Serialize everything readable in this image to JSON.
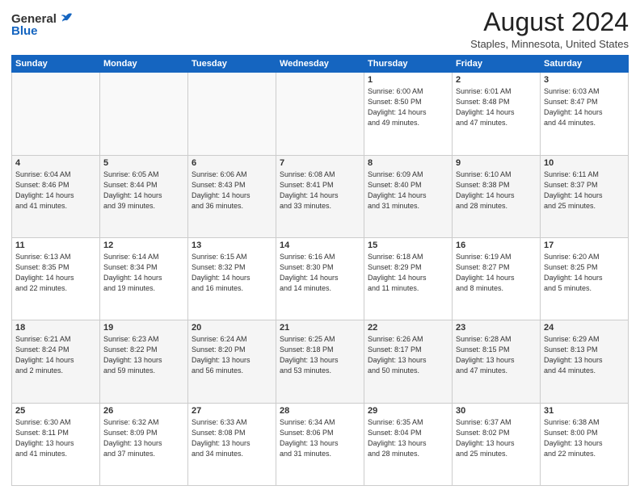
{
  "logo": {
    "general": "General",
    "blue": "Blue"
  },
  "title": "August 2024",
  "location": "Staples, Minnesota, United States",
  "headers": [
    "Sunday",
    "Monday",
    "Tuesday",
    "Wednesday",
    "Thursday",
    "Friday",
    "Saturday"
  ],
  "rows": [
    [
      {
        "day": "",
        "detail": ""
      },
      {
        "day": "",
        "detail": ""
      },
      {
        "day": "",
        "detail": ""
      },
      {
        "day": "",
        "detail": ""
      },
      {
        "day": "1",
        "detail": "Sunrise: 6:00 AM\nSunset: 8:50 PM\nDaylight: 14 hours\nand 49 minutes."
      },
      {
        "day": "2",
        "detail": "Sunrise: 6:01 AM\nSunset: 8:48 PM\nDaylight: 14 hours\nand 47 minutes."
      },
      {
        "day": "3",
        "detail": "Sunrise: 6:03 AM\nSunset: 8:47 PM\nDaylight: 14 hours\nand 44 minutes."
      }
    ],
    [
      {
        "day": "4",
        "detail": "Sunrise: 6:04 AM\nSunset: 8:46 PM\nDaylight: 14 hours\nand 41 minutes."
      },
      {
        "day": "5",
        "detail": "Sunrise: 6:05 AM\nSunset: 8:44 PM\nDaylight: 14 hours\nand 39 minutes."
      },
      {
        "day": "6",
        "detail": "Sunrise: 6:06 AM\nSunset: 8:43 PM\nDaylight: 14 hours\nand 36 minutes."
      },
      {
        "day": "7",
        "detail": "Sunrise: 6:08 AM\nSunset: 8:41 PM\nDaylight: 14 hours\nand 33 minutes."
      },
      {
        "day": "8",
        "detail": "Sunrise: 6:09 AM\nSunset: 8:40 PM\nDaylight: 14 hours\nand 31 minutes."
      },
      {
        "day": "9",
        "detail": "Sunrise: 6:10 AM\nSunset: 8:38 PM\nDaylight: 14 hours\nand 28 minutes."
      },
      {
        "day": "10",
        "detail": "Sunrise: 6:11 AM\nSunset: 8:37 PM\nDaylight: 14 hours\nand 25 minutes."
      }
    ],
    [
      {
        "day": "11",
        "detail": "Sunrise: 6:13 AM\nSunset: 8:35 PM\nDaylight: 14 hours\nand 22 minutes."
      },
      {
        "day": "12",
        "detail": "Sunrise: 6:14 AM\nSunset: 8:34 PM\nDaylight: 14 hours\nand 19 minutes."
      },
      {
        "day": "13",
        "detail": "Sunrise: 6:15 AM\nSunset: 8:32 PM\nDaylight: 14 hours\nand 16 minutes."
      },
      {
        "day": "14",
        "detail": "Sunrise: 6:16 AM\nSunset: 8:30 PM\nDaylight: 14 hours\nand 14 minutes."
      },
      {
        "day": "15",
        "detail": "Sunrise: 6:18 AM\nSunset: 8:29 PM\nDaylight: 14 hours\nand 11 minutes."
      },
      {
        "day": "16",
        "detail": "Sunrise: 6:19 AM\nSunset: 8:27 PM\nDaylight: 14 hours\nand 8 minutes."
      },
      {
        "day": "17",
        "detail": "Sunrise: 6:20 AM\nSunset: 8:25 PM\nDaylight: 14 hours\nand 5 minutes."
      }
    ],
    [
      {
        "day": "18",
        "detail": "Sunrise: 6:21 AM\nSunset: 8:24 PM\nDaylight: 14 hours\nand 2 minutes."
      },
      {
        "day": "19",
        "detail": "Sunrise: 6:23 AM\nSunset: 8:22 PM\nDaylight: 13 hours\nand 59 minutes."
      },
      {
        "day": "20",
        "detail": "Sunrise: 6:24 AM\nSunset: 8:20 PM\nDaylight: 13 hours\nand 56 minutes."
      },
      {
        "day": "21",
        "detail": "Sunrise: 6:25 AM\nSunset: 8:18 PM\nDaylight: 13 hours\nand 53 minutes."
      },
      {
        "day": "22",
        "detail": "Sunrise: 6:26 AM\nSunset: 8:17 PM\nDaylight: 13 hours\nand 50 minutes."
      },
      {
        "day": "23",
        "detail": "Sunrise: 6:28 AM\nSunset: 8:15 PM\nDaylight: 13 hours\nand 47 minutes."
      },
      {
        "day": "24",
        "detail": "Sunrise: 6:29 AM\nSunset: 8:13 PM\nDaylight: 13 hours\nand 44 minutes."
      }
    ],
    [
      {
        "day": "25",
        "detail": "Sunrise: 6:30 AM\nSunset: 8:11 PM\nDaylight: 13 hours\nand 41 minutes."
      },
      {
        "day": "26",
        "detail": "Sunrise: 6:32 AM\nSunset: 8:09 PM\nDaylight: 13 hours\nand 37 minutes."
      },
      {
        "day": "27",
        "detail": "Sunrise: 6:33 AM\nSunset: 8:08 PM\nDaylight: 13 hours\nand 34 minutes."
      },
      {
        "day": "28",
        "detail": "Sunrise: 6:34 AM\nSunset: 8:06 PM\nDaylight: 13 hours\nand 31 minutes."
      },
      {
        "day": "29",
        "detail": "Sunrise: 6:35 AM\nSunset: 8:04 PM\nDaylight: 13 hours\nand 28 minutes."
      },
      {
        "day": "30",
        "detail": "Sunrise: 6:37 AM\nSunset: 8:02 PM\nDaylight: 13 hours\nand 25 minutes."
      },
      {
        "day": "31",
        "detail": "Sunrise: 6:38 AM\nSunset: 8:00 PM\nDaylight: 13 hours\nand 22 minutes."
      }
    ]
  ]
}
